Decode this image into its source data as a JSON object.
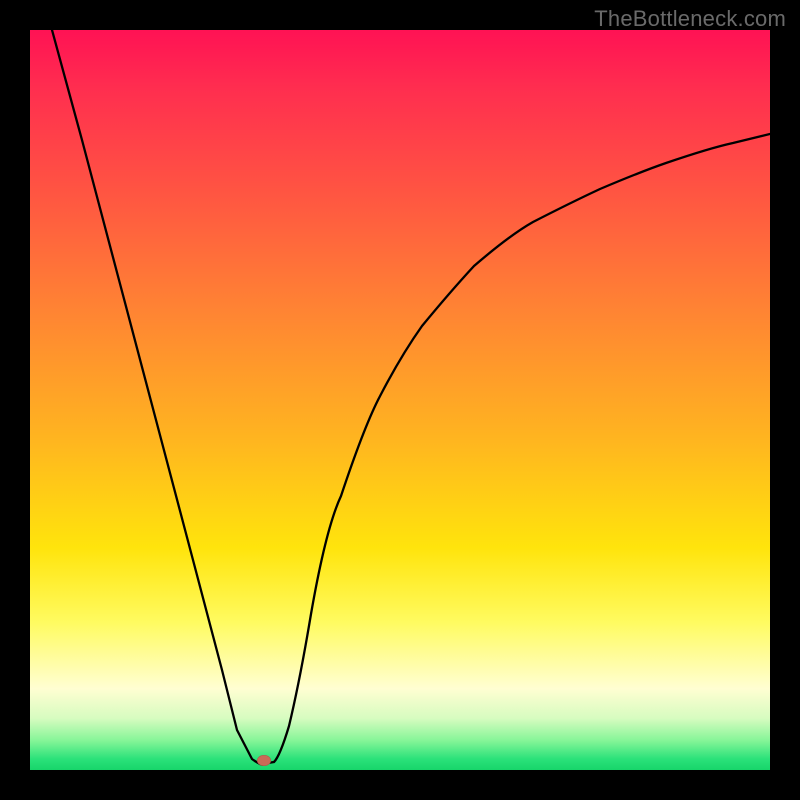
{
  "watermark": "TheBottleneck.com",
  "chart_data": {
    "type": "line",
    "title": "",
    "xlabel": "",
    "ylabel": "",
    "xlim": [
      0,
      100
    ],
    "ylim": [
      0,
      100
    ],
    "grid": false,
    "legend": false,
    "series": [
      {
        "name": "bottleneck-curve",
        "x": [
          3,
          7,
          12,
          17,
          22,
          26,
          28,
          30,
          31.5,
          33,
          35,
          38,
          42,
          47,
          53,
          60,
          68,
          77,
          86,
          95,
          100
        ],
        "y": [
          100,
          85,
          66,
          47,
          28,
          13,
          5,
          1,
          0.5,
          1,
          6,
          21,
          37,
          50,
          60,
          68,
          74,
          79,
          82.5,
          85,
          86
        ]
      }
    ],
    "marker": {
      "x": 31.5,
      "y": 0.5,
      "color": "#c96a57"
    },
    "background_gradient": [
      {
        "stop": 0,
        "color": "#ff1254"
      },
      {
        "stop": 22,
        "color": "#ff5542"
      },
      {
        "stop": 55,
        "color": "#ffb420"
      },
      {
        "stop": 80,
        "color": "#fffb60"
      },
      {
        "stop": 96,
        "color": "#86f598"
      },
      {
        "stop": 100,
        "color": "#17d56a"
      }
    ]
  }
}
